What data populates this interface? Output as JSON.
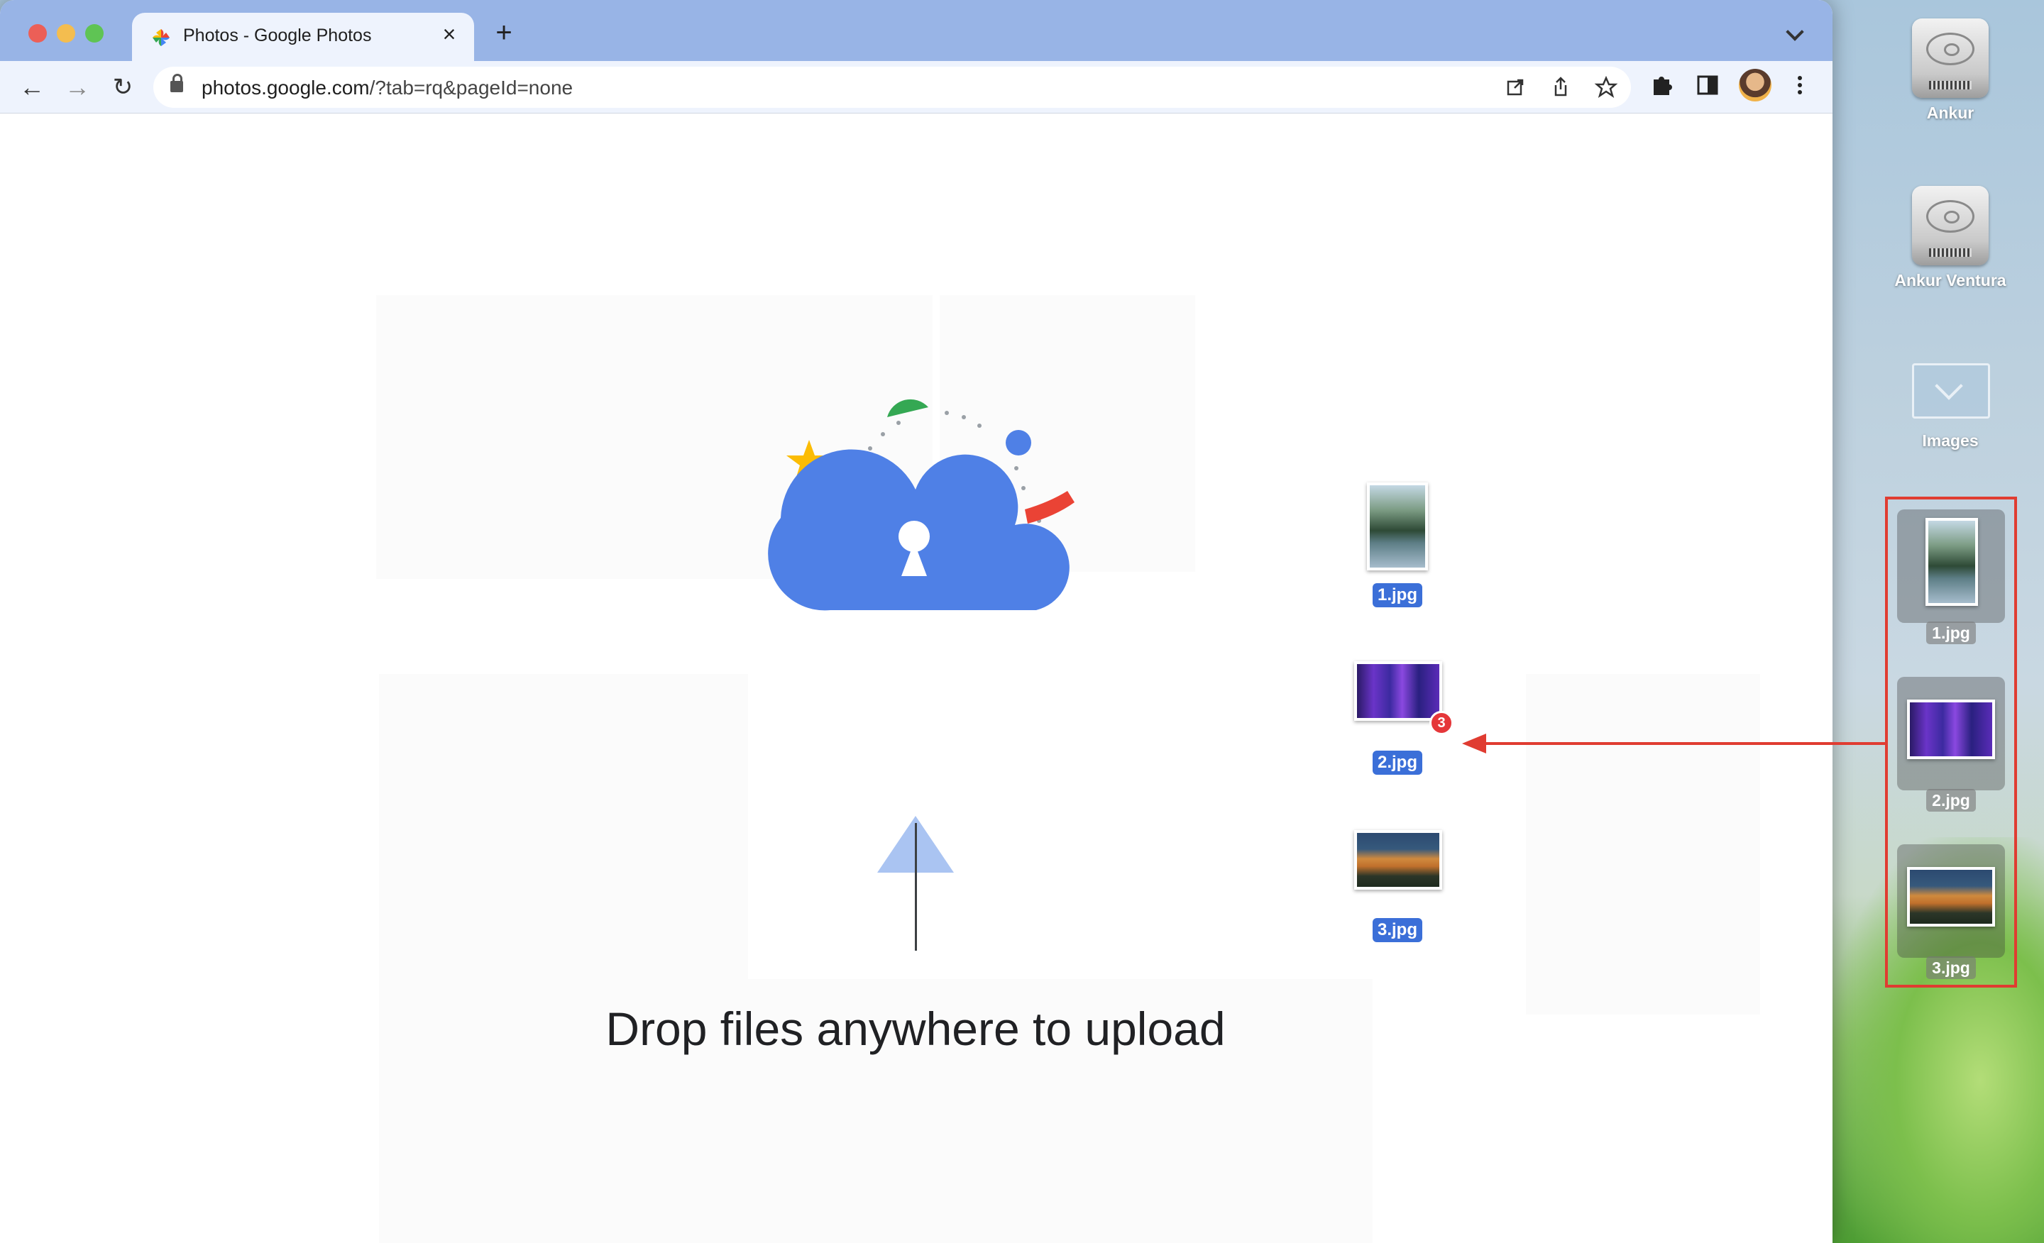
{
  "browser": {
    "tab_title": "Photos - Google Photos",
    "tab_close": "×",
    "new_tab": "+",
    "url_host": "photos.google.com",
    "url_rest": "/?tab=rq&pageId=none"
  },
  "page": {
    "drop_message": "Drop files anywhere to upload",
    "dragged_files": [
      {
        "label": "1.jpg"
      },
      {
        "label": "2.jpg"
      },
      {
        "label": "3.jpg"
      }
    ],
    "drag_count": "3"
  },
  "desktop": {
    "icons": [
      {
        "label": "Ankur"
      },
      {
        "label": "Ankur Ventura"
      },
      {
        "label": "Images"
      }
    ],
    "files": [
      {
        "label": "1.jpg"
      },
      {
        "label": "2.jpg"
      },
      {
        "label": "3.jpg"
      }
    ]
  },
  "colors": {
    "annotation": "#e03c31",
    "cloud": "#4f80e6",
    "drag_label": "#3b6fd8"
  }
}
